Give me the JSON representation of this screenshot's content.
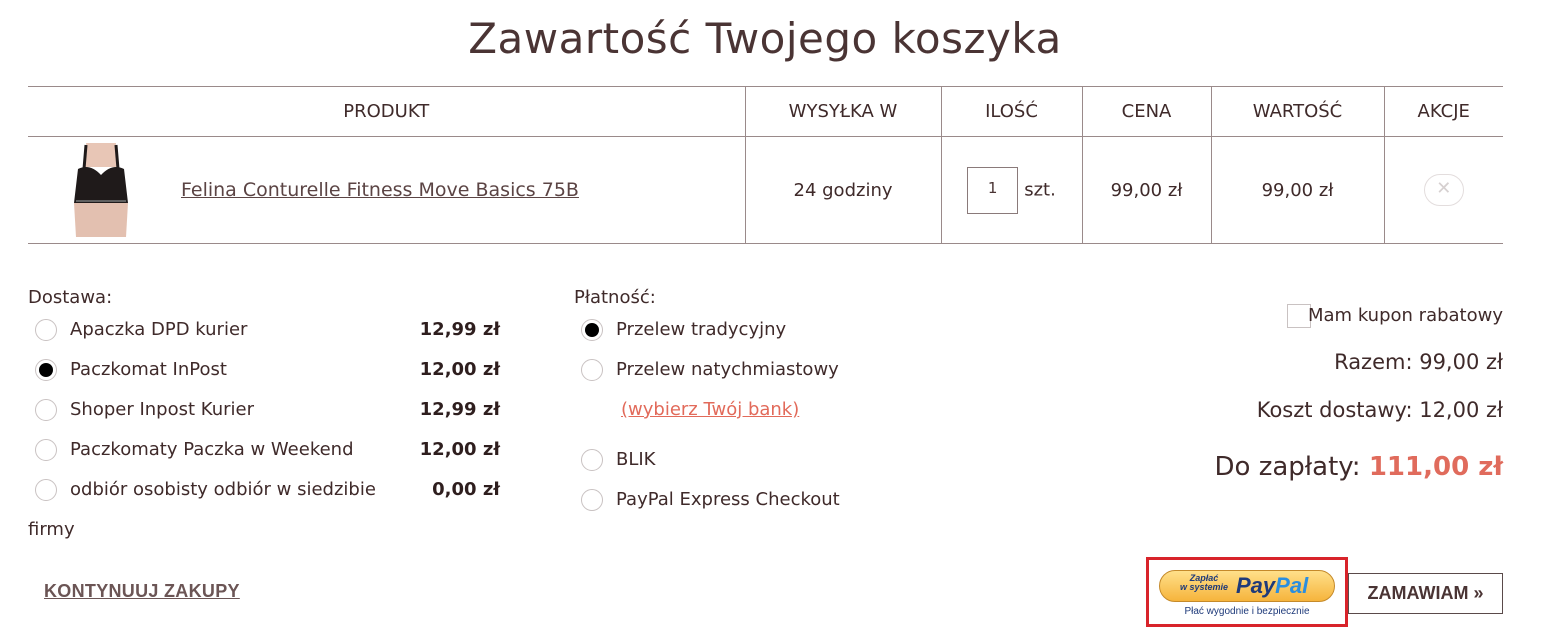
{
  "page": {
    "title": "Zawartość Twojego koszyka"
  },
  "cart": {
    "headers": {
      "product": "PRODUKT",
      "shipping": "WYSYŁKA W",
      "quantity": "ILOŚĆ",
      "price": "CENA",
      "value": "WARTOŚĆ",
      "actions": "AKCJE"
    },
    "items": [
      {
        "name": "Felina Conturelle Fitness Move Basics 75B",
        "shipping": "24 godziny",
        "quantity": "1",
        "unit": "szt.",
        "price": "99,00 zł",
        "value": "99,00 zł",
        "remove_icon": "close-icon"
      }
    ]
  },
  "delivery": {
    "label": "Dostawa:",
    "options": [
      {
        "label": "Apaczka DPD kurier",
        "price": "12,99 zł",
        "selected": false
      },
      {
        "label": "Paczkomat InPost",
        "price": "12,00 zł",
        "selected": true
      },
      {
        "label": "Shoper Inpost Kurier",
        "price": "12,99 zł",
        "selected": false
      },
      {
        "label": "Paczkomaty Paczka w Weekend",
        "price": "12,00 zł",
        "selected": false
      },
      {
        "label": "odbiór osobisty odbiór w siedzibie",
        "label_wrap": "firmy",
        "price": "0,00 zł",
        "selected": false
      }
    ]
  },
  "payment": {
    "label": "Płatność:",
    "options": [
      {
        "label": "Przelew tradycyjny",
        "selected": true
      },
      {
        "label": "Przelew natychmiastowy",
        "selected": false
      },
      {
        "label": "BLIK",
        "selected": false
      },
      {
        "label": "PayPal Express Checkout",
        "selected": false
      }
    ],
    "bank_link": "(wybierz Twój bank)"
  },
  "summary": {
    "coupon_label": "Mam kupon rabatowy",
    "subtotal": "Razem: 99,00 zł",
    "shipping_cost": "Koszt dostawy: 12,00 zł",
    "total_label": "Do zapłaty:",
    "total_amount": "111,00 zł",
    "accent_color": "#e06b5c"
  },
  "actions": {
    "continue": "KONTYNUUJ ZAKUPY",
    "paypal_line1": "Zapłać",
    "paypal_line2": "w systemie",
    "paypal_brand_1": "Pay",
    "paypal_brand_2": "Pal",
    "paypal_tagline": "Płać wygodnie i bezpiecznie",
    "order": "ZAMAWIAM »"
  }
}
